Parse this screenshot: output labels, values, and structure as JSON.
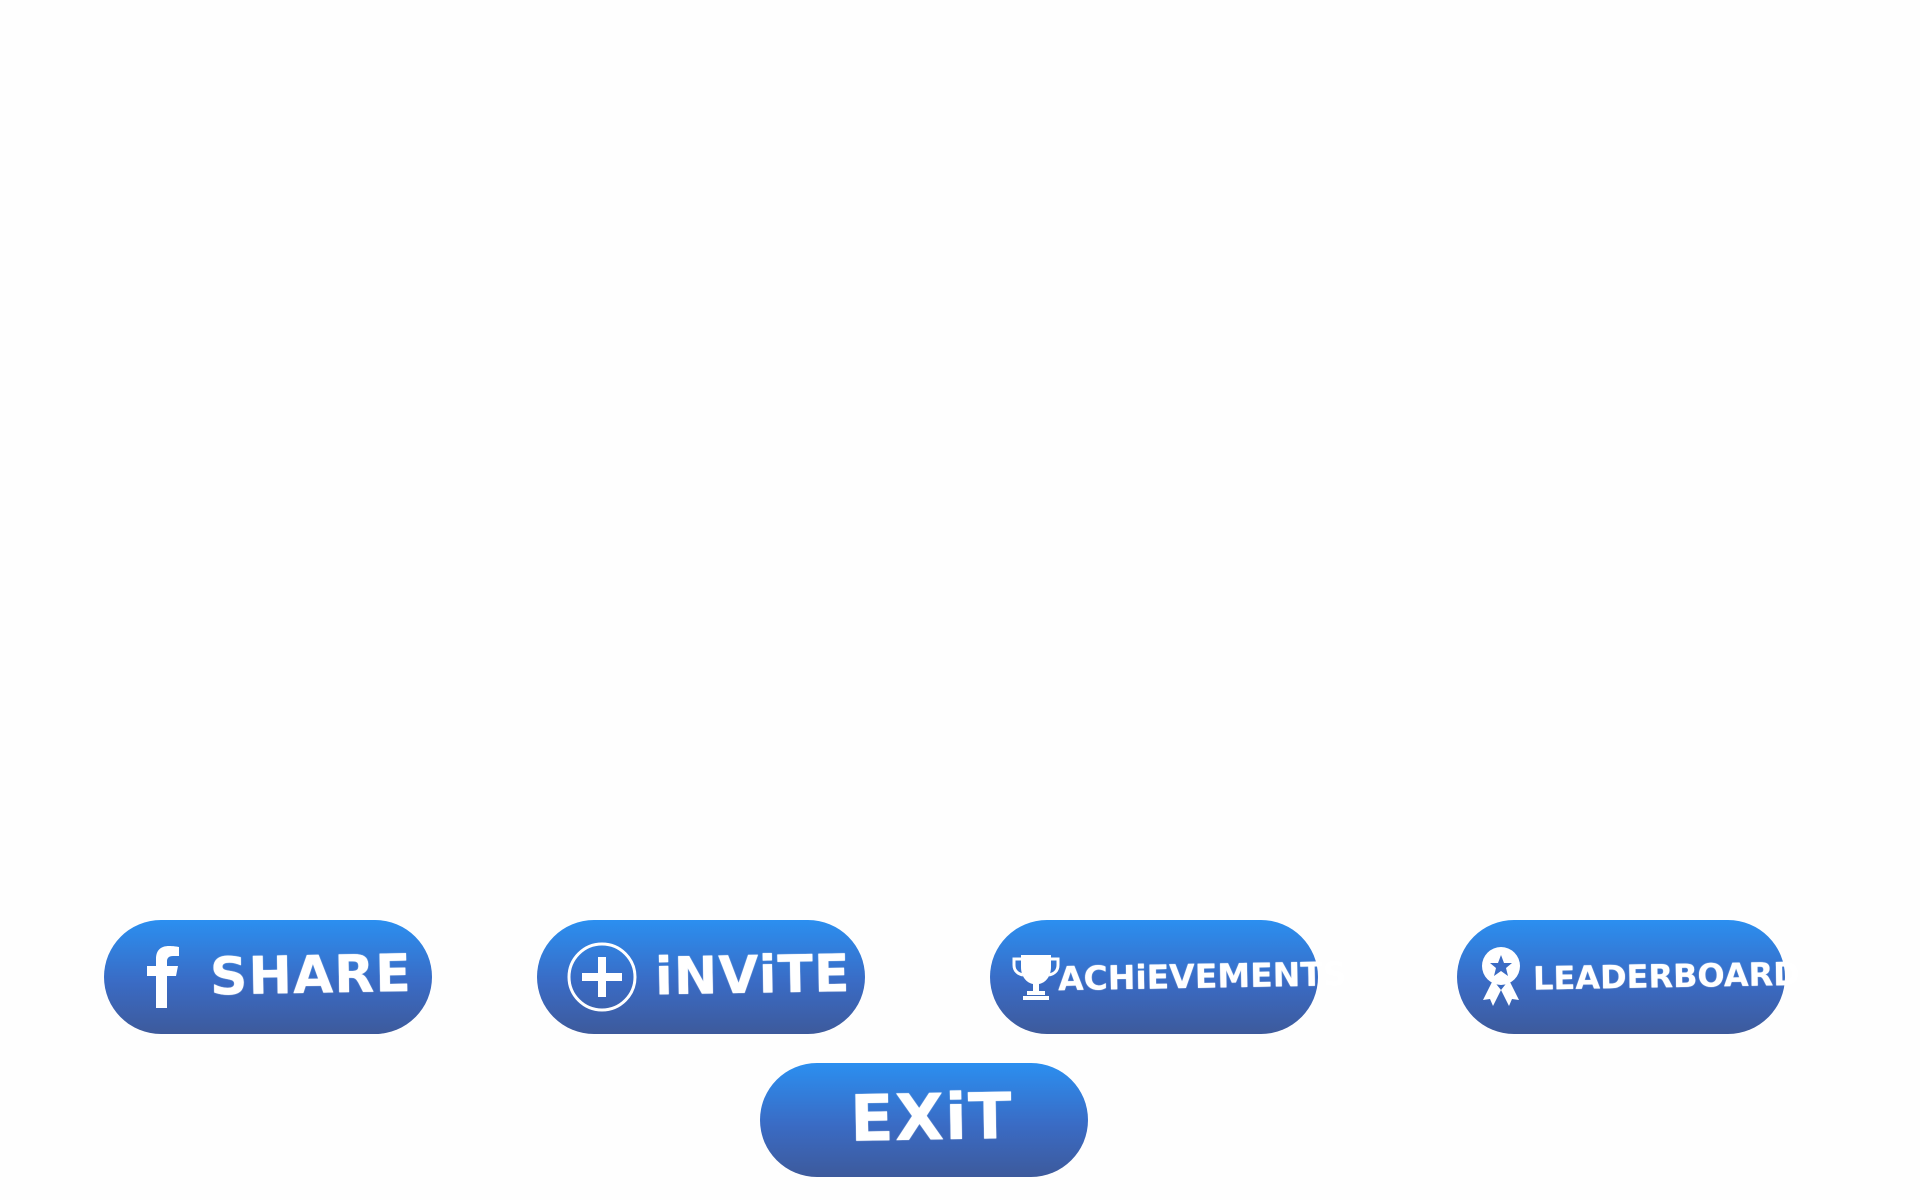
{
  "menu": {
    "share": {
      "label": "SHARE",
      "icon": "facebook-icon"
    },
    "invite": {
      "label": "iNViTE",
      "icon": "plus-circle-icon"
    },
    "achievements": {
      "label": "ACHiEVEMENTS",
      "icon": "trophy-icon"
    },
    "leaderboard": {
      "label": "LEADERBOARD",
      "icon": "award-ribbon-icon"
    },
    "exit": {
      "label": "EXiT"
    }
  },
  "colors": {
    "button_top": "#2b8ff0",
    "button_bottom": "#3d5a9c",
    "text": "#ffffff",
    "background": "#fefefe"
  }
}
